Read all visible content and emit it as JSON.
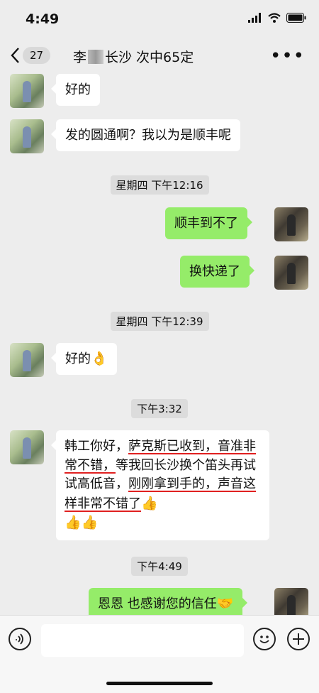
{
  "status_bar": {
    "time": "4:49"
  },
  "header": {
    "back_count": "27",
    "title_prefix": "李",
    "title_suffix": "长沙 次中65定",
    "more": "•••"
  },
  "messages": [
    {
      "side": "left",
      "text": "好的"
    },
    {
      "side": "left",
      "text": "发的圆通啊？我以为是顺丰呢"
    },
    {
      "timestamp": "星期四 下午12:16"
    },
    {
      "side": "right",
      "text": "顺丰到不了"
    },
    {
      "side": "right",
      "text": "换快递了"
    },
    {
      "timestamp": "星期四 下午12:39"
    },
    {
      "side": "left",
      "text": "好的",
      "emoji": "👌"
    },
    {
      "timestamp": "下午3:32"
    },
    {
      "side": "left",
      "parts": [
        "韩工你好，",
        "萨克斯已收到，音准非常不错，",
        "等我回长沙换个笛头再试试高低音，",
        "刚刚拿到手的，声音这样非常不错了",
        "👍",
        "👍👍"
      ]
    },
    {
      "timestamp": "下午4:49"
    },
    {
      "side": "right",
      "text": "恩恩 也感谢您的信任",
      "emoji": "🤝"
    }
  ],
  "input_bar": {
    "voice_icon": "voice-icon",
    "emoji_icon": "emoji-icon",
    "plus_icon": "plus-icon"
  }
}
